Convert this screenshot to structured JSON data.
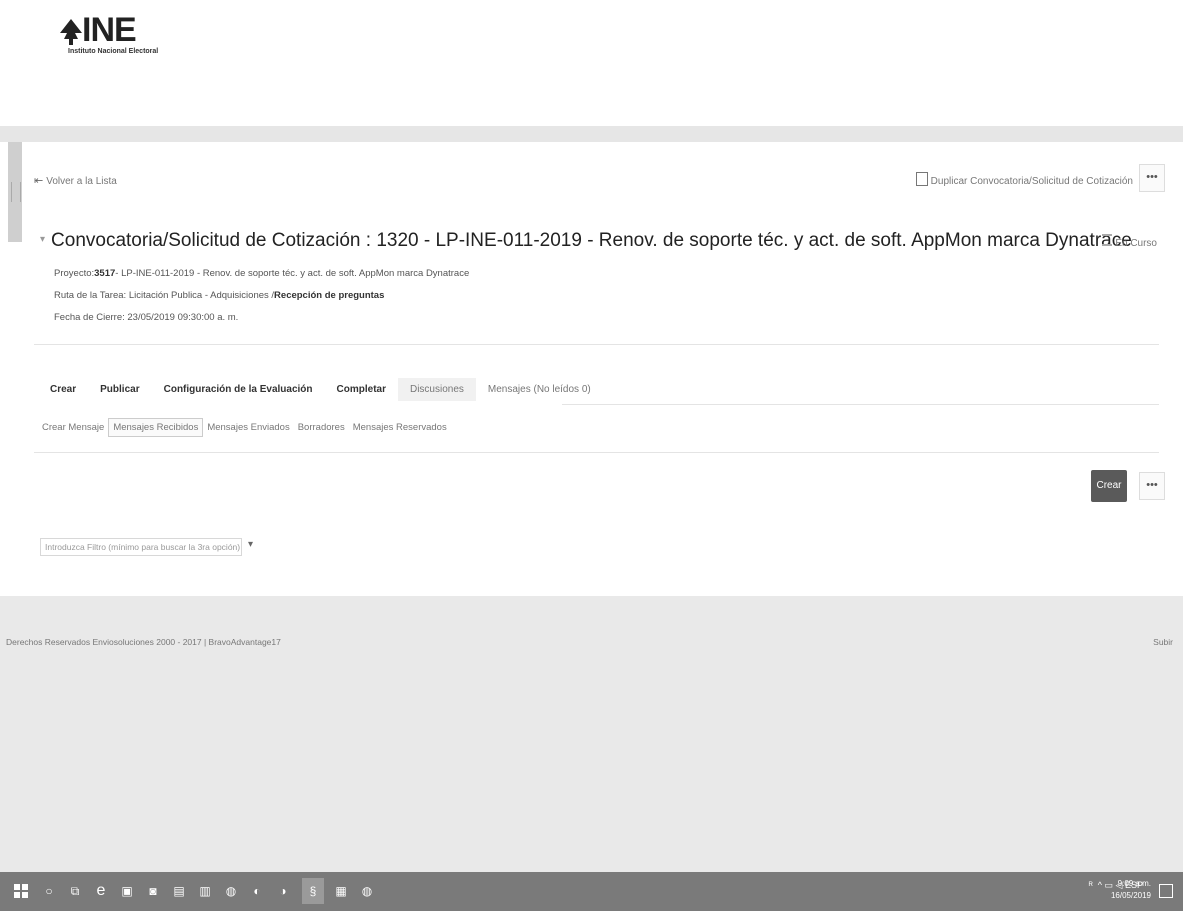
{
  "brand": {
    "logo_text": "INE",
    "logo_subtitle": "Instituto Nacional Electoral"
  },
  "card": {
    "back_link": "Volver a la Lista",
    "duplicate_link": "Duplicar Convocatoria/Solicitud de Cotización",
    "more_label": "•••",
    "title": "Convocatoria/Solicitud de Cotización : 1320 - LP-INE-011-2019 - Renov. de soporte téc. y act. de soft. AppMon marca Dynatrace",
    "status": "En Curso",
    "project_label": "Proyecto:",
    "project_number": "3517",
    "project_desc": "- LP-INE-011-2019 - Renov. de soporte téc. y act. de soft. AppMon marca Dynatrace",
    "route_label": "Ruta de la Tarea: Licitación Publica - Adquisiciones /",
    "route_bold": "Recepción de preguntas",
    "close_date": "Fecha de Cierre: 23/05/2019 09:30:00 a. m."
  },
  "tabs": [
    {
      "label": "Crear",
      "style": "bold"
    },
    {
      "label": "Publicar",
      "style": "bold"
    },
    {
      "label": "Configuración de la Evaluación",
      "style": "bold"
    },
    {
      "label": "Completar",
      "style": "bold"
    },
    {
      "label": "Discusiones",
      "style": "active"
    },
    {
      "label": "Mensajes (No leídos 0)",
      "style": "light"
    }
  ],
  "subtabs": [
    {
      "label": "Crear Mensaje",
      "active": false
    },
    {
      "label": "Mensajes Recibidos",
      "active": true
    },
    {
      "label": "Mensajes Enviados",
      "active": false
    },
    {
      "label": "Borradores",
      "active": false
    },
    {
      "label": "Mensajes Reservados",
      "active": false
    }
  ],
  "actions": {
    "create_label": "Crear",
    "more_label": "•••"
  },
  "filter": {
    "placeholder": "Introduzca Filtro (mínimo para buscar la 3ra opción)"
  },
  "footer": {
    "copyright": "Derechos Reservados Enviosoluciones 2000 - 2017 | BravoAdvantage17",
    "top_link": "Subir"
  },
  "taskbar": {
    "clock_time": "9:09 a.m.",
    "clock_date": "16/05/2019",
    "tray_text": "ESP"
  },
  "colors": {
    "create_button": "#5a5a5a",
    "page_gray": "#e9e9e9",
    "taskbar": "#7a7a7a"
  }
}
